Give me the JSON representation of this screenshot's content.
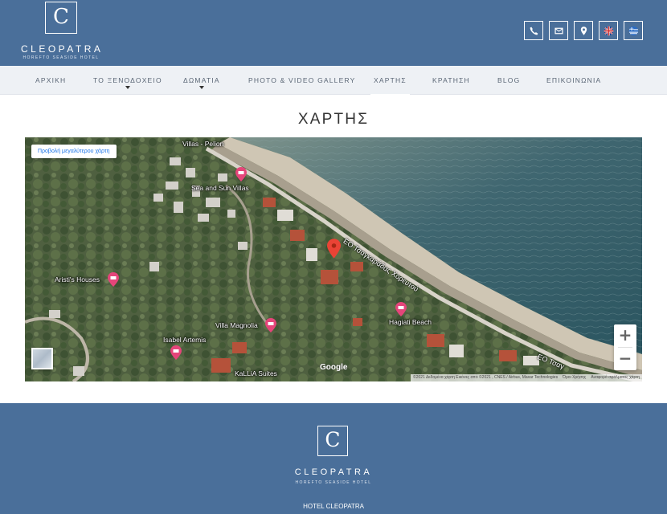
{
  "brand": {
    "letter": "C",
    "name": "CLEOPATRA",
    "tagline": "HOREFTO SEASIDE HOTEL"
  },
  "header_icons": [
    {
      "name": "phone-icon"
    },
    {
      "name": "email-icon"
    },
    {
      "name": "location-icon"
    },
    {
      "name": "uk-flag-icon"
    },
    {
      "name": "greek-flag-icon"
    }
  ],
  "nav": {
    "items": [
      {
        "label": "ΑΡΧΙΚΗ",
        "dropdown": false
      },
      {
        "label": "ΤΟ ΞΕΝΟΔΟΧΕΙΟ",
        "dropdown": true
      },
      {
        "label": "ΔΩΜΑΤΙΑ",
        "dropdown": true
      },
      {
        "label": "PHOTO & VIDEO GALLERY",
        "dropdown": false
      },
      {
        "label": "ΧΑΡΤΗΣ",
        "dropdown": false,
        "active": true
      },
      {
        "label": "ΚΡΑΤΗΣΗ",
        "dropdown": false
      },
      {
        "label": "BLOG",
        "dropdown": false
      },
      {
        "label": "ΕΠΙΚΟΙΝΩΝΙΑ",
        "dropdown": false
      }
    ]
  },
  "page": {
    "title": "ΧΑΡΤΗΣ"
  },
  "map": {
    "larger_map_label": "Προβολή μεγαλύτερου χάρτη",
    "places": {
      "villas_pelion": "Villas - Pelion",
      "sea_sun": "Sea and Sun Villas",
      "aristi": "Aristi's Houses",
      "magnolia": "Villa Magnolia",
      "isabel": "Isabel Artemis",
      "kallia": "KaLLiA Suites",
      "hagiati": "Hagiati Beach"
    },
    "road_1": "ΕΟ Τσαγκαράδας Χορευτού",
    "road_2": "ΕΟ Τσαγ",
    "zoom_in": "+",
    "zoom_out": "−",
    "google": "Google",
    "attribution": "©2021 Δεδομένα χάρτη Εικόνες από ©2021 , CNES / Airbus, Maxar Technologies",
    "terms": "Όροι Χρήσης",
    "report": "Αναφορά σφάλματος χάρτη"
  },
  "footer": {
    "letter": "C",
    "name": "CLEOPATRA",
    "tagline": "HOREFTO SEASIDE HOTEL",
    "hotel_name": "HOTEL CLEOPATRA"
  },
  "colors": {
    "brand_blue": "#4a6f9a",
    "nav_bg": "#eef1f5",
    "pin_red": "#ea4335",
    "poi_pink": "#e5457a"
  }
}
